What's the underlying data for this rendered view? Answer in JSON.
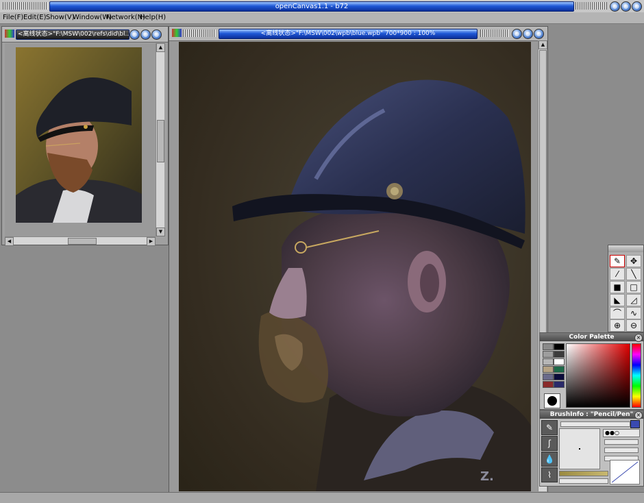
{
  "app": {
    "title": "openCanvas1.1 - b72"
  },
  "menu": {
    "items": [
      "File(F)",
      "Edit(E)",
      "Show(V)",
      "Window(W)",
      "Network(N)",
      "Help(H)"
    ]
  },
  "reference_window": {
    "title": "<离线状态>\"F:\\MSW\\002\\refs\\did\\bl..."
  },
  "canvas_window": {
    "title": "<离线状态>\"F:\\MSW\\002\\wpb\\blue.wpb\" 700*900 : 100%"
  },
  "color_palette": {
    "title": "Color Palette",
    "swatches": [
      "#8a8a8a",
      "#000000",
      "#9e9e9e",
      "#3c3c3c",
      "#b6b6b6",
      "#ffffff",
      "#b5a284",
      "#1e6a4a",
      "#6a6a8a",
      "#0a0a3a",
      "#8a2a2a",
      "#2a2a6a"
    ],
    "current_color": "#000000"
  },
  "brush_info": {
    "title": "BrushInfo : \"Pencil/Pen\""
  },
  "colors": {
    "title_blue": "#1f58d6",
    "canvas_bg": "#3a3226",
    "workspace": "#8c8c8c"
  }
}
